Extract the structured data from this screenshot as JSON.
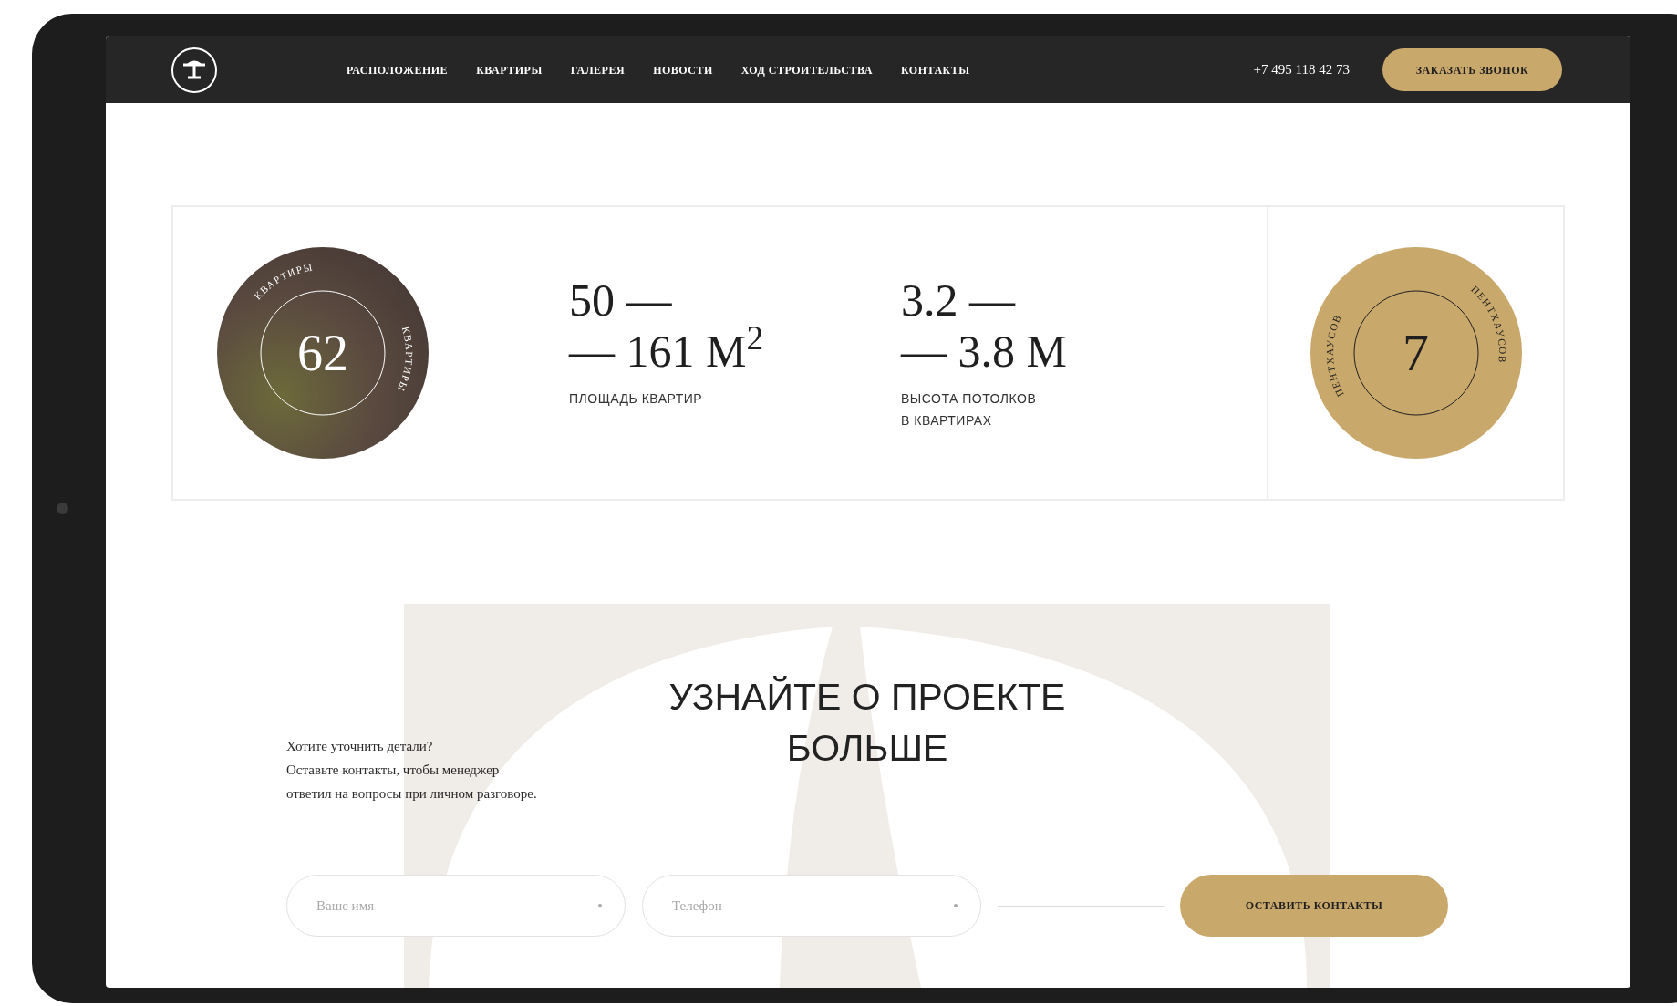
{
  "nav": {
    "links": [
      "РАСПОЛОЖЕНИЕ",
      "КВАРТИРЫ",
      "ГАЛЕРЕЯ",
      "НОВОСТИ",
      "ХОД СТРОИТЕЛЬСТВА",
      "КОНТАКТЫ"
    ],
    "phone": "+7 495 118 42 73",
    "cta": "ЗАКАЗАТЬ ЗВОНОК"
  },
  "stats": {
    "apartments": {
      "number": "62",
      "ring_texts": [
        "КВАРТИРЫ",
        "КВАРТИРЫ"
      ]
    },
    "items": [
      {
        "value_lines": [
          "50 —",
          "— 161 М$^{2}$"
        ],
        "caption_lines": [
          "ПЛОЩАДЬ КВАРТИР"
        ]
      },
      {
        "value_lines": [
          "3.2 —",
          "— 3.8 М"
        ],
        "caption_lines": [
          "ВЫСОТА ПОТОЛКОВ",
          "В КВАРТИРАХ"
        ]
      }
    ],
    "penthouses": {
      "number": "7",
      "ring_texts": [
        "ПЕНТХАУСОВ",
        "ПЕНТХАУСОВ"
      ]
    }
  },
  "contact": {
    "title_lines": [
      "УЗНАЙТЕ О ПРОЕКТЕ",
      "БОЛЬШЕ"
    ],
    "intro_lines": [
      "Хотите уточнить детали?",
      "Оставьте контакты, чтобы менеджер",
      "ответил на вопросы при личном разговоре."
    ],
    "fields": [
      {
        "placeholder": "Ваше имя"
      },
      {
        "placeholder": "Телефон"
      }
    ],
    "submit": "ОСТАВИТЬ КОНТАКТЫ"
  }
}
